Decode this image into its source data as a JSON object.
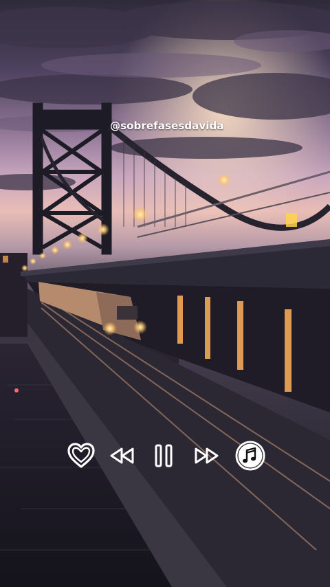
{
  "watermark": {
    "handle": "@sobrefasesdavida"
  },
  "player": {
    "controls": [
      {
        "icon": "heart-outline-icon"
      },
      {
        "icon": "rewind-icon"
      },
      {
        "icon": "pause-icon"
      },
      {
        "icon": "fast-forward-icon"
      },
      {
        "icon": "music-note-icon"
      }
    ],
    "icon_color": "#ffffff"
  },
  "scene": {
    "description_colors": {
      "sky_top": "#3a3346",
      "sky_mid": "#a88aa8",
      "sky_glow": "#f3c6b4",
      "water": "#1b1a24",
      "light": "#ffd27a"
    }
  }
}
